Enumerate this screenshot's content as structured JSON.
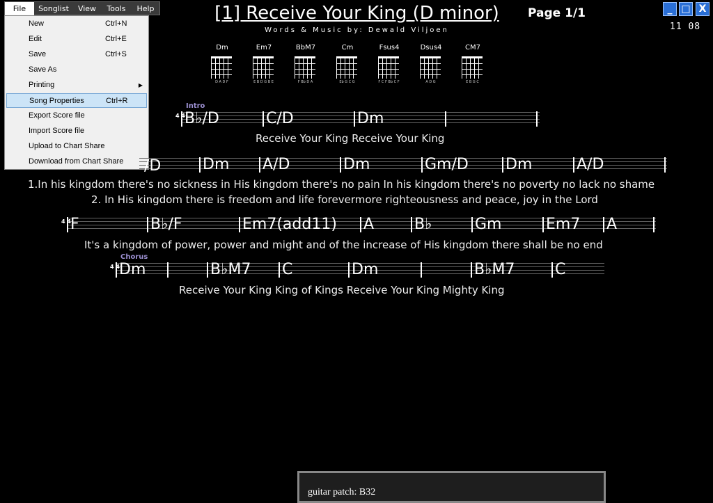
{
  "menubar": [
    {
      "label": "File",
      "active": true
    },
    {
      "label": "Songlist"
    },
    {
      "label": "View"
    },
    {
      "label": "Tools"
    },
    {
      "label": "Help"
    }
  ],
  "file_menu": [
    {
      "label": "New",
      "shortcut": "Ctrl+N"
    },
    {
      "label": "Edit",
      "shortcut": "Ctrl+E"
    },
    {
      "label": "Save",
      "shortcut": "Ctrl+S"
    },
    {
      "label": "Save As",
      "shortcut": ""
    },
    {
      "label": "Printing",
      "shortcut": "",
      "submenu": true
    },
    {
      "label": "Song Properties",
      "shortcut": "Ctrl+R",
      "highlighted": true
    },
    {
      "label": "Export Score file",
      "shortcut": ""
    },
    {
      "label": "Import Score file",
      "shortcut": ""
    },
    {
      "label": "Upload to Chart Share",
      "shortcut": ""
    },
    {
      "label": "Download from Chart Share",
      "shortcut": ""
    }
  ],
  "song": {
    "title": "[1] Receive Your King (D minor)",
    "credit": "Words & Music by: Dewald Viljoen",
    "page": "Page 1/1",
    "time": "11  08"
  },
  "window_buttons": {
    "minimize": "_",
    "maximize": "□",
    "close": "X"
  },
  "chords": [
    {
      "name": "Dm",
      "strings": "D A D F"
    },
    {
      "name": "Em7",
      "strings": "E B D G B E"
    },
    {
      "name": "BbM7",
      "strings": "F Bb D A"
    },
    {
      "name": "Cm",
      "strings": "Eb G C G"
    },
    {
      "name": "Fsus4",
      "strings": "F C F Bb C F"
    },
    {
      "name": "Dsus4",
      "strings": "A D G"
    },
    {
      "name": "CM7",
      "strings": "E B G C"
    }
  ],
  "lines": [
    {
      "section": "Intro",
      "time_sig": "4 4",
      "lyric": "Receive Your King Receive Your King"
    },
    {
      "section": "",
      "time_sig": "",
      "lyric1": "1.In his kingdom there's no sickness in His kingdom there's no pain In his kingdom there's no poverty no lack no shame",
      "lyric2": "2. In His kingdom there is freedom and life forevermore righteousness and peace, joy in the Lord"
    },
    {
      "section": "",
      "time_sig": "4 4",
      "lyric": "It's a kingdom of power, power and  might and of the increase of His kingdom there shall be no end"
    },
    {
      "section": "Chorus",
      "time_sig": "4 4",
      "lyric": "Receive Your King  King of Kings  Receive Your King  Mighty King"
    }
  ],
  "chord_symbols": {
    "l1": [
      "B♭/D",
      "C/D",
      "Dm",
      ""
    ],
    "l2": [
      "/D",
      "Dm",
      "A/D",
      "Dm",
      "Gm/D",
      "Dm",
      "A/D"
    ],
    "l3": [
      "F",
      "B♭/F",
      "Em7(add11)",
      "A",
      "B♭",
      "Gm",
      "Em7",
      "A"
    ],
    "l4": [
      "Dm",
      "",
      "B♭M7",
      "C",
      "Dm",
      "",
      "B♭M7",
      "C"
    ]
  },
  "status": {
    "text": "guitar patch: B32"
  }
}
